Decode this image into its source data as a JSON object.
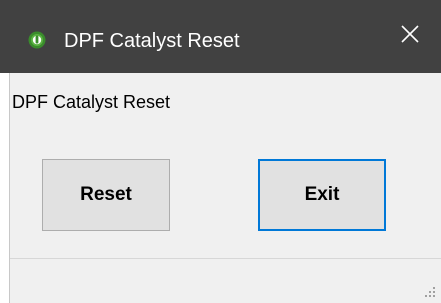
{
  "window": {
    "title": "DPF Catalyst Reset",
    "close_glyph": "✕",
    "icon": "app-icon"
  },
  "content": {
    "label": "DPF Catalyst Reset",
    "reset_label": "Reset",
    "exit_label": "Exit"
  },
  "colors": {
    "titlebar": "#414141",
    "client": "#f0f0f0",
    "button_face": "#e1e1e1",
    "focus_border": "#0078d7"
  }
}
